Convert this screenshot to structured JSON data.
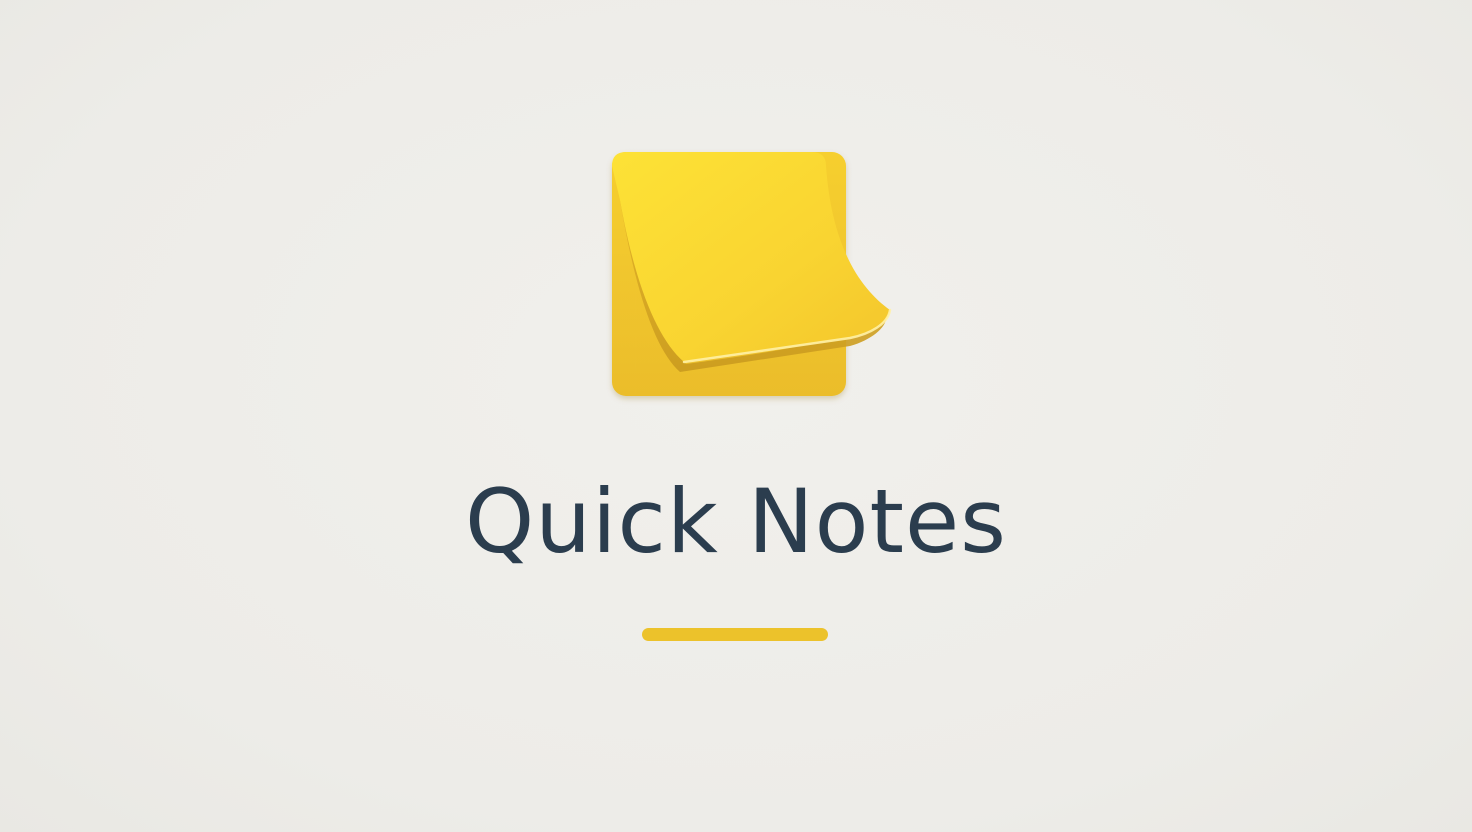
{
  "app": {
    "title": "Quick Notes",
    "logo_icon": "sticky-note-icon"
  },
  "colors": {
    "background": "#efeeea",
    "title_text": "#2b3d4e",
    "accent": "#ecc22b",
    "note_base": "#f0c12a",
    "note_page": "#fbd933"
  }
}
